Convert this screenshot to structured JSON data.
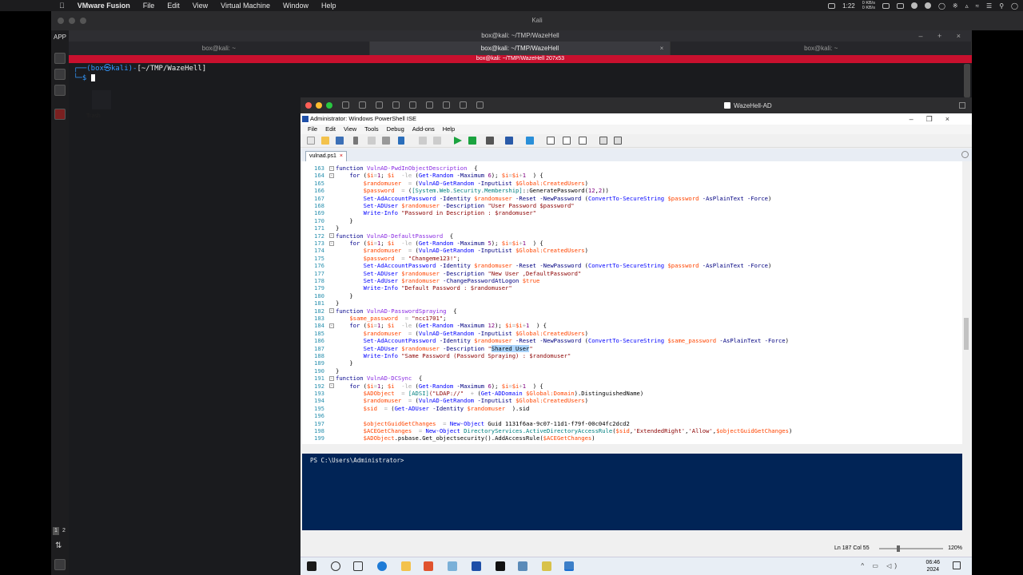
{
  "mac_menubar": {
    "app_name": "VMware Fusion",
    "menus": [
      "File",
      "Edit",
      "View",
      "Virtual Machine",
      "Window",
      "Help"
    ],
    "clock": "1:22",
    "net_up": "0 KB/s",
    "net_down": "0 KB/s"
  },
  "vm_window": {
    "title": "Kali"
  },
  "kali": {
    "side_label": "APP",
    "workspaces": [
      "1",
      "2"
    ],
    "terminal_title": "box@kali: ~/TMP/WazeHell",
    "tabs": [
      {
        "label": "box@kali: ~"
      },
      {
        "label": "box@kali: ~/TMP/WazeHell"
      },
      {
        "label": "box@kali: ~"
      }
    ],
    "red_bar": "box@kali: ~/TMP/WazeHell 207x53",
    "prompt_user": "(box㉿kali)",
    "prompt_path": "[~/TMP/WazeHell]",
    "prompt_symbol": "$",
    "desktop_label": "Trash"
  },
  "win_vm": {
    "title": "WazeHell-AD",
    "ise_title": "Administrator: Windows PowerShell ISE",
    "menu": [
      "File",
      "Edit",
      "View",
      "Tools",
      "Debug",
      "Add-ons",
      "Help"
    ],
    "file_tab": "vulnad.ps1",
    "console_prompt": "PS C:\\Users\\Administrator>",
    "status_pos": "Ln 187  Col 55",
    "zoom": "120%",
    "taskbar_time": "06:46",
    "taskbar_date": "2024"
  },
  "code": [
    {
      "n": "163",
      "fold": "-",
      "t": [
        [
          "kw",
          "function "
        ],
        [
          "fn",
          "VulnAD-PwdInObjectDescription"
        ],
        [
          "",
          "  {"
        ]
      ]
    },
    {
      "n": "164",
      "fold": "-",
      "t": [
        [
          "",
          "    "
        ],
        [
          "kw",
          "for "
        ],
        [
          "",
          "("
        ],
        [
          "var",
          "$i"
        ],
        [
          "op",
          "="
        ],
        [
          "num",
          "1"
        ],
        [
          "",
          "; "
        ],
        [
          "var",
          "$i"
        ],
        [
          "",
          "  "
        ],
        [
          "op",
          "-le "
        ],
        [
          "",
          "("
        ],
        [
          "cmd",
          "Get-Random "
        ],
        [
          "par",
          "-Maximum "
        ],
        [
          "num",
          "6"
        ],
        [
          "",
          "); "
        ],
        [
          "var",
          "$i"
        ],
        [
          "op",
          "="
        ],
        [
          "var",
          "$i"
        ],
        [
          "op",
          "+"
        ],
        [
          "num",
          "1"
        ],
        [
          "",
          "  ) {"
        ]
      ]
    },
    {
      "n": "165",
      "fold": "",
      "t": [
        [
          "",
          "        "
        ],
        [
          "var",
          "$randomuser"
        ],
        [
          "",
          "  "
        ],
        [
          "op",
          "= "
        ],
        [
          "",
          "("
        ],
        [
          "cmd",
          "VulnAD-GetRandom "
        ],
        [
          "par",
          "-InputList "
        ],
        [
          "var",
          "$Global:CreatedUsers"
        ],
        [
          "",
          ")"
        ]
      ]
    },
    {
      "n": "166",
      "fold": "",
      "t": [
        [
          "",
          "        "
        ],
        [
          "var",
          "$password"
        ],
        [
          "",
          "  "
        ],
        [
          "op",
          "= "
        ],
        [
          "",
          "("
        ],
        [
          "typ",
          "[System.Web.Security.Membership]"
        ],
        [
          "",
          "::GeneratePassword("
        ],
        [
          "num",
          "12"
        ],
        [
          "",
          ","
        ],
        [
          "num",
          "2"
        ],
        [
          "",
          "))"
        ]
      ]
    },
    {
      "n": "167",
      "fold": "",
      "t": [
        [
          "",
          "        "
        ],
        [
          "cmd",
          "Set-AdAccountPassword "
        ],
        [
          "par",
          "-Identity "
        ],
        [
          "var",
          "$randomuser "
        ],
        [
          "par",
          "-Reset "
        ],
        [
          "par",
          "-NewPassword "
        ],
        [
          "",
          "("
        ],
        [
          "cmd",
          "ConvertTo-SecureString "
        ],
        [
          "var",
          "$password "
        ],
        [
          "par",
          "-AsPlainText "
        ],
        [
          "par",
          "-Force"
        ],
        [
          "",
          ")"
        ]
      ]
    },
    {
      "n": "168",
      "fold": "",
      "t": [
        [
          "",
          "        "
        ],
        [
          "cmd",
          "Set-ADUser "
        ],
        [
          "var",
          "$randomuser "
        ],
        [
          "par",
          "-Description "
        ],
        [
          "str",
          "\"User Password $password\""
        ]
      ]
    },
    {
      "n": "169",
      "fold": "",
      "t": [
        [
          "",
          "        "
        ],
        [
          "cmd",
          "Write-Info "
        ],
        [
          "str",
          "\"Password in Description : $randomuser\""
        ]
      ]
    },
    {
      "n": "170",
      "fold": "",
      "t": [
        [
          "",
          "    }"
        ]
      ]
    },
    {
      "n": "171",
      "fold": "",
      "t": [
        [
          "",
          "}"
        ]
      ]
    },
    {
      "n": "172",
      "fold": "-",
      "t": [
        [
          "kw",
          "function "
        ],
        [
          "fn",
          "VulnAD-DefaultPassword"
        ],
        [
          "",
          "  {"
        ]
      ]
    },
    {
      "n": "173",
      "fold": "-",
      "t": [
        [
          "",
          "    "
        ],
        [
          "kw",
          "for "
        ],
        [
          "",
          "("
        ],
        [
          "var",
          "$i"
        ],
        [
          "op",
          "="
        ],
        [
          "num",
          "1"
        ],
        [
          "",
          "; "
        ],
        [
          "var",
          "$i"
        ],
        [
          "",
          "  "
        ],
        [
          "op",
          "-le "
        ],
        [
          "",
          "("
        ],
        [
          "cmd",
          "Get-Random "
        ],
        [
          "par",
          "-Maximum "
        ],
        [
          "num",
          "5"
        ],
        [
          "",
          "); "
        ],
        [
          "var",
          "$i"
        ],
        [
          "op",
          "="
        ],
        [
          "var",
          "$i"
        ],
        [
          "op",
          "+"
        ],
        [
          "num",
          "1"
        ],
        [
          "",
          "  ) {"
        ]
      ]
    },
    {
      "n": "174",
      "fold": "",
      "t": [
        [
          "",
          "        "
        ],
        [
          "var",
          "$randomuser"
        ],
        [
          "",
          "  "
        ],
        [
          "op",
          "= "
        ],
        [
          "",
          "("
        ],
        [
          "cmd",
          "VulnAD-GetRandom "
        ],
        [
          "par",
          "-InputList "
        ],
        [
          "var",
          "$Global:CreatedUsers"
        ],
        [
          "",
          ")"
        ]
      ]
    },
    {
      "n": "175",
      "fold": "",
      "t": [
        [
          "",
          "        "
        ],
        [
          "var",
          "$password"
        ],
        [
          "",
          "  "
        ],
        [
          "op",
          "= "
        ],
        [
          "str",
          "\"Changeme123!\""
        ],
        [
          "",
          ";"
        ]
      ]
    },
    {
      "n": "176",
      "fold": "",
      "t": [
        [
          "",
          "        "
        ],
        [
          "cmd",
          "Set-AdAccountPassword "
        ],
        [
          "par",
          "-Identity "
        ],
        [
          "var",
          "$randomuser "
        ],
        [
          "par",
          "-Reset "
        ],
        [
          "par",
          "-NewPassword "
        ],
        [
          "",
          "("
        ],
        [
          "cmd",
          "ConvertTo-SecureString "
        ],
        [
          "var",
          "$password "
        ],
        [
          "par",
          "-AsPlainText "
        ],
        [
          "par",
          "-Force"
        ],
        [
          "",
          ")"
        ]
      ]
    },
    {
      "n": "177",
      "fold": "",
      "t": [
        [
          "",
          "        "
        ],
        [
          "cmd",
          "Set-ADUser "
        ],
        [
          "var",
          "$randomuser "
        ],
        [
          "par",
          "-Description "
        ],
        [
          "str",
          "\"New User ,DefaultPassword\""
        ]
      ]
    },
    {
      "n": "178",
      "fold": "",
      "t": [
        [
          "",
          "        "
        ],
        [
          "cmd",
          "Set-AdUser "
        ],
        [
          "var",
          "$randomuser "
        ],
        [
          "par",
          "-ChangePasswordAtLogon "
        ],
        [
          "var",
          "$true"
        ]
      ]
    },
    {
      "n": "179",
      "fold": "",
      "t": [
        [
          "",
          "        "
        ],
        [
          "cmd",
          "Write-Info "
        ],
        [
          "str",
          "\"Default Password : $randomuser\""
        ]
      ]
    },
    {
      "n": "180",
      "fold": "",
      "t": [
        [
          "",
          "    }"
        ]
      ]
    },
    {
      "n": "181",
      "fold": "",
      "t": [
        [
          "",
          "}"
        ]
      ]
    },
    {
      "n": "182",
      "fold": "-",
      "t": [
        [
          "kw",
          "function "
        ],
        [
          "fn",
          "VulnAD-PasswordSpraying"
        ],
        [
          "",
          "  {"
        ]
      ]
    },
    {
      "n": "183",
      "fold": "",
      "t": [
        [
          "",
          "    "
        ],
        [
          "var",
          "$same_password"
        ],
        [
          "",
          "  "
        ],
        [
          "op",
          "= "
        ],
        [
          "str",
          "\"ncc1701\""
        ],
        [
          "",
          ";"
        ]
      ]
    },
    {
      "n": "184",
      "fold": "-",
      "t": [
        [
          "",
          "    "
        ],
        [
          "kw",
          "for "
        ],
        [
          "",
          "("
        ],
        [
          "var",
          "$i"
        ],
        [
          "op",
          "="
        ],
        [
          "num",
          "1"
        ],
        [
          "",
          "; "
        ],
        [
          "var",
          "$i"
        ],
        [
          "",
          "  "
        ],
        [
          "op",
          "-le "
        ],
        [
          "",
          "("
        ],
        [
          "cmd",
          "Get-Random "
        ],
        [
          "par",
          "-Maximum "
        ],
        [
          "num",
          "12"
        ],
        [
          "",
          "); "
        ],
        [
          "var",
          "$i"
        ],
        [
          "op",
          "="
        ],
        [
          "var",
          "$i"
        ],
        [
          "op",
          "+"
        ],
        [
          "num",
          "1"
        ],
        [
          "",
          "  ) {"
        ]
      ]
    },
    {
      "n": "185",
      "fold": "",
      "t": [
        [
          "",
          "        "
        ],
        [
          "var",
          "$randomuser"
        ],
        [
          "",
          "  "
        ],
        [
          "op",
          "= "
        ],
        [
          "",
          "("
        ],
        [
          "cmd",
          "VulnAD-GetRandom "
        ],
        [
          "par",
          "-InputList "
        ],
        [
          "var",
          "$Global:CreatedUsers"
        ],
        [
          "",
          ")"
        ]
      ]
    },
    {
      "n": "186",
      "fold": "",
      "t": [
        [
          "",
          "        "
        ],
        [
          "cmd",
          "Set-AdAccountPassword "
        ],
        [
          "par",
          "-Identity "
        ],
        [
          "var",
          "$randomuser "
        ],
        [
          "par",
          "-Reset "
        ],
        [
          "par",
          "-NewPassword "
        ],
        [
          "",
          "("
        ],
        [
          "cmd",
          "ConvertTo-SecureString "
        ],
        [
          "var",
          "$same_password "
        ],
        [
          "par",
          "-AsPlainText "
        ],
        [
          "par",
          "-Force"
        ],
        [
          "",
          ")"
        ]
      ]
    },
    {
      "n": "187",
      "fold": "",
      "t": [
        [
          "",
          "        "
        ],
        [
          "cmd",
          "Set-ADUser "
        ],
        [
          "var",
          "$randomuser "
        ],
        [
          "par",
          "-Description "
        ],
        [
          "str",
          "\""
        ],
        [
          "sel",
          "Shared User"
        ],
        [
          "str",
          "\""
        ]
      ]
    },
    {
      "n": "188",
      "fold": "",
      "t": [
        [
          "",
          "        "
        ],
        [
          "cmd",
          "Write-Info "
        ],
        [
          "str",
          "\"Same Password (Password Spraying) : $randomuser\""
        ]
      ]
    },
    {
      "n": "189",
      "fold": "",
      "t": [
        [
          "",
          "    }"
        ]
      ]
    },
    {
      "n": "190",
      "fold": "",
      "t": [
        [
          "",
          "}"
        ]
      ]
    },
    {
      "n": "191",
      "fold": "-",
      "t": [
        [
          "kw",
          "function "
        ],
        [
          "fn",
          "VulnAD-DCSync"
        ],
        [
          "",
          "  {"
        ]
      ]
    },
    {
      "n": "192",
      "fold": "-",
      "t": [
        [
          "",
          "    "
        ],
        [
          "kw",
          "for "
        ],
        [
          "",
          "("
        ],
        [
          "var",
          "$i"
        ],
        [
          "op",
          "="
        ],
        [
          "num",
          "1"
        ],
        [
          "",
          "; "
        ],
        [
          "var",
          "$i"
        ],
        [
          "",
          "  "
        ],
        [
          "op",
          "-le "
        ],
        [
          "",
          "("
        ],
        [
          "cmd",
          "Get-Random "
        ],
        [
          "par",
          "-Maximum "
        ],
        [
          "num",
          "6"
        ],
        [
          "",
          "); "
        ],
        [
          "var",
          "$i"
        ],
        [
          "op",
          "="
        ],
        [
          "var",
          "$i"
        ],
        [
          "op",
          "+"
        ],
        [
          "num",
          "1"
        ],
        [
          "",
          "  ) {"
        ]
      ]
    },
    {
      "n": "193",
      "fold": "",
      "t": [
        [
          "",
          "        "
        ],
        [
          "var",
          "$ADObject"
        ],
        [
          "",
          "  "
        ],
        [
          "op",
          "= "
        ],
        [
          "typ",
          "[ADSI]"
        ],
        [
          "str",
          "(\"LDAP://\""
        ],
        [
          "",
          "  "
        ],
        [
          "op",
          "+ "
        ],
        [
          "",
          "("
        ],
        [
          "cmd",
          "Get-ADDomain "
        ],
        [
          "var",
          "$Global:Domain"
        ],
        [
          "",
          ").DistinguishedName)"
        ]
      ]
    },
    {
      "n": "194",
      "fold": "",
      "t": [
        [
          "",
          "        "
        ],
        [
          "var",
          "$randomuser"
        ],
        [
          "",
          "  "
        ],
        [
          "op",
          "= "
        ],
        [
          "",
          "("
        ],
        [
          "cmd",
          "VulnAD-GetRandom "
        ],
        [
          "par",
          "-InputList "
        ],
        [
          "var",
          "$Global:CreatedUsers"
        ],
        [
          "",
          ")"
        ]
      ]
    },
    {
      "n": "195",
      "fold": "",
      "t": [
        [
          "",
          "        "
        ],
        [
          "var",
          "$sid"
        ],
        [
          "",
          "  "
        ],
        [
          "op",
          "= "
        ],
        [
          "",
          "("
        ],
        [
          "cmd",
          "Get-ADUser "
        ],
        [
          "par",
          "-Identity "
        ],
        [
          "var",
          "$randomuser"
        ],
        [
          "",
          "  ).sid"
        ]
      ]
    },
    {
      "n": "196",
      "fold": "",
      "t": [
        [
          "",
          ""
        ]
      ]
    },
    {
      "n": "197",
      "fold": "",
      "t": [
        [
          "",
          "        "
        ],
        [
          "var",
          "$objectGuidGetChanges"
        ],
        [
          "",
          "  "
        ],
        [
          "op",
          "= "
        ],
        [
          "cmd",
          "New-Object "
        ],
        [
          "",
          "Guid 1131f6aa-9c07-11d1-f79f-00c04fc2dcd2"
        ]
      ]
    },
    {
      "n": "198",
      "fold": "",
      "t": [
        [
          "",
          "        "
        ],
        [
          "var",
          "$ACEGetChanges"
        ],
        [
          "",
          "  "
        ],
        [
          "op",
          "= "
        ],
        [
          "cmd",
          "New-Object "
        ],
        [
          "typ",
          "DirectoryServices.ActiveDirectoryAccessRule"
        ],
        [
          "",
          "("
        ],
        [
          "var",
          "$sid"
        ],
        [
          "",
          ","
        ],
        [
          "str",
          "'ExtendedRight'"
        ],
        [
          "",
          ","
        ],
        [
          "str",
          "'Allow'"
        ],
        [
          "",
          ","
        ],
        [
          "var",
          "$objectGuidGetChanges"
        ],
        [
          "",
          ")"
        ]
      ]
    },
    {
      "n": "199",
      "fold": "",
      "t": [
        [
          "",
          "        "
        ],
        [
          "var",
          "$ADObject"
        ],
        [
          "",
          ".psbase.Get_objectsecurity().AddAccessRule("
        ],
        [
          "var",
          "$ACEGetChanges"
        ],
        [
          "",
          ")"
        ]
      ]
    }
  ]
}
